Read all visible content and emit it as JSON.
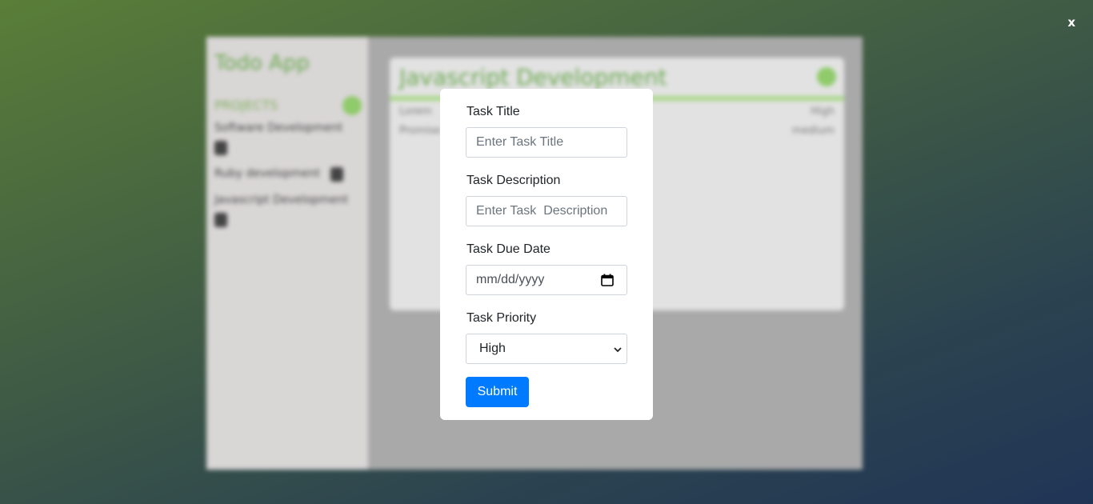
{
  "close_label": "x",
  "background": {
    "app_title": "Todo App",
    "projects_label": "PROJECTS",
    "projects": [
      {
        "name": "Software Development"
      },
      {
        "name": "Ruby development"
      },
      {
        "name": "Javascript Development"
      }
    ],
    "card_title": "Javascript Development",
    "rows": [
      {
        "left": "Lorem",
        "right": "High"
      },
      {
        "left": "Promise",
        "right": "medium"
      }
    ]
  },
  "form": {
    "title_label": "Task Title",
    "title_placeholder": "Enter Task Title",
    "description_label": "Task Description",
    "description_placeholder": "Enter Task  Description",
    "due_date_label": "Task Due Date",
    "due_date_placeholder": "mm/dd/yyyy",
    "priority_label": "Task Priority",
    "priority_value": "High",
    "submit_label": "Submit"
  },
  "colors": {
    "accent": "#007bff",
    "brand_green": "#6aa84f"
  }
}
